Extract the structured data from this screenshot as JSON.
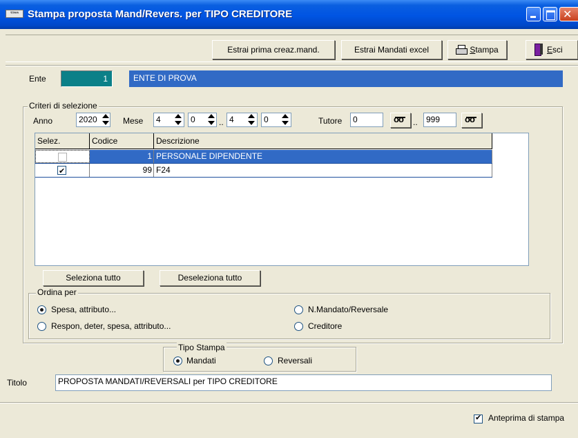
{
  "window": {
    "title": "Stampa proposta Mand/Revers. per TIPO CREDITORE",
    "icon_text": "ᵗⁱⁿⁿ"
  },
  "toolbar": {
    "estrai_prima_label": "Estrai prima creaz.mand.",
    "estrai_excel_label": "Estrai Mandati excel",
    "stampa_label": "Stampa",
    "esci_label": "Esci"
  },
  "ente": {
    "label": "Ente",
    "code": "1",
    "name": "ENTE DI PROVA"
  },
  "criteri": {
    "title": "Criteri di selezione",
    "anno_label": "Anno",
    "anno_value": "2020",
    "mese_label": "Mese",
    "mese_from": "4",
    "day_from": "0",
    "range_sep": "..",
    "mese_to": "4",
    "day_to": "0",
    "tutore_label": "Tutore",
    "tutore_from": "0",
    "tutore_to": "999"
  },
  "grid": {
    "columns": [
      "Selez.",
      "Codice",
      "Descrizione"
    ],
    "rows": [
      {
        "selected": false,
        "codice": "1",
        "descrizione": "PERSONALE DIPENDENTE",
        "highlight": true
      },
      {
        "selected": true,
        "codice": "99",
        "descrizione": "F24",
        "highlight": false
      }
    ]
  },
  "buttons": {
    "seleziona_tutto": "Seleziona tutto",
    "deseleziona_tutto": "Deseleziona tutto"
  },
  "ordina": {
    "title": "Ordina per",
    "options": [
      {
        "label": "Spesa, attributo...",
        "checked": true
      },
      {
        "label": "N.Mandato/Reversale",
        "checked": false
      },
      {
        "label": "Respon, deter, spesa, attributo...",
        "checked": false
      },
      {
        "label": "Creditore",
        "checked": false
      }
    ]
  },
  "tipo_stampa": {
    "title": "Tipo Stampa",
    "options": [
      {
        "label": "Mandati",
        "checked": true
      },
      {
        "label": "Reversali",
        "checked": false
      }
    ]
  },
  "titolo": {
    "label": "Titolo",
    "value": "PROPOSTA MANDATI/REVERSALI per TIPO CREDITORE"
  },
  "anteprima": {
    "label": "Anteprima di stampa",
    "checked": true
  },
  "colors": {
    "title_bar": "#0054e3",
    "selection": "#316ac5",
    "ente_code_bg": "#0b8088",
    "face": "#ece9d8"
  }
}
